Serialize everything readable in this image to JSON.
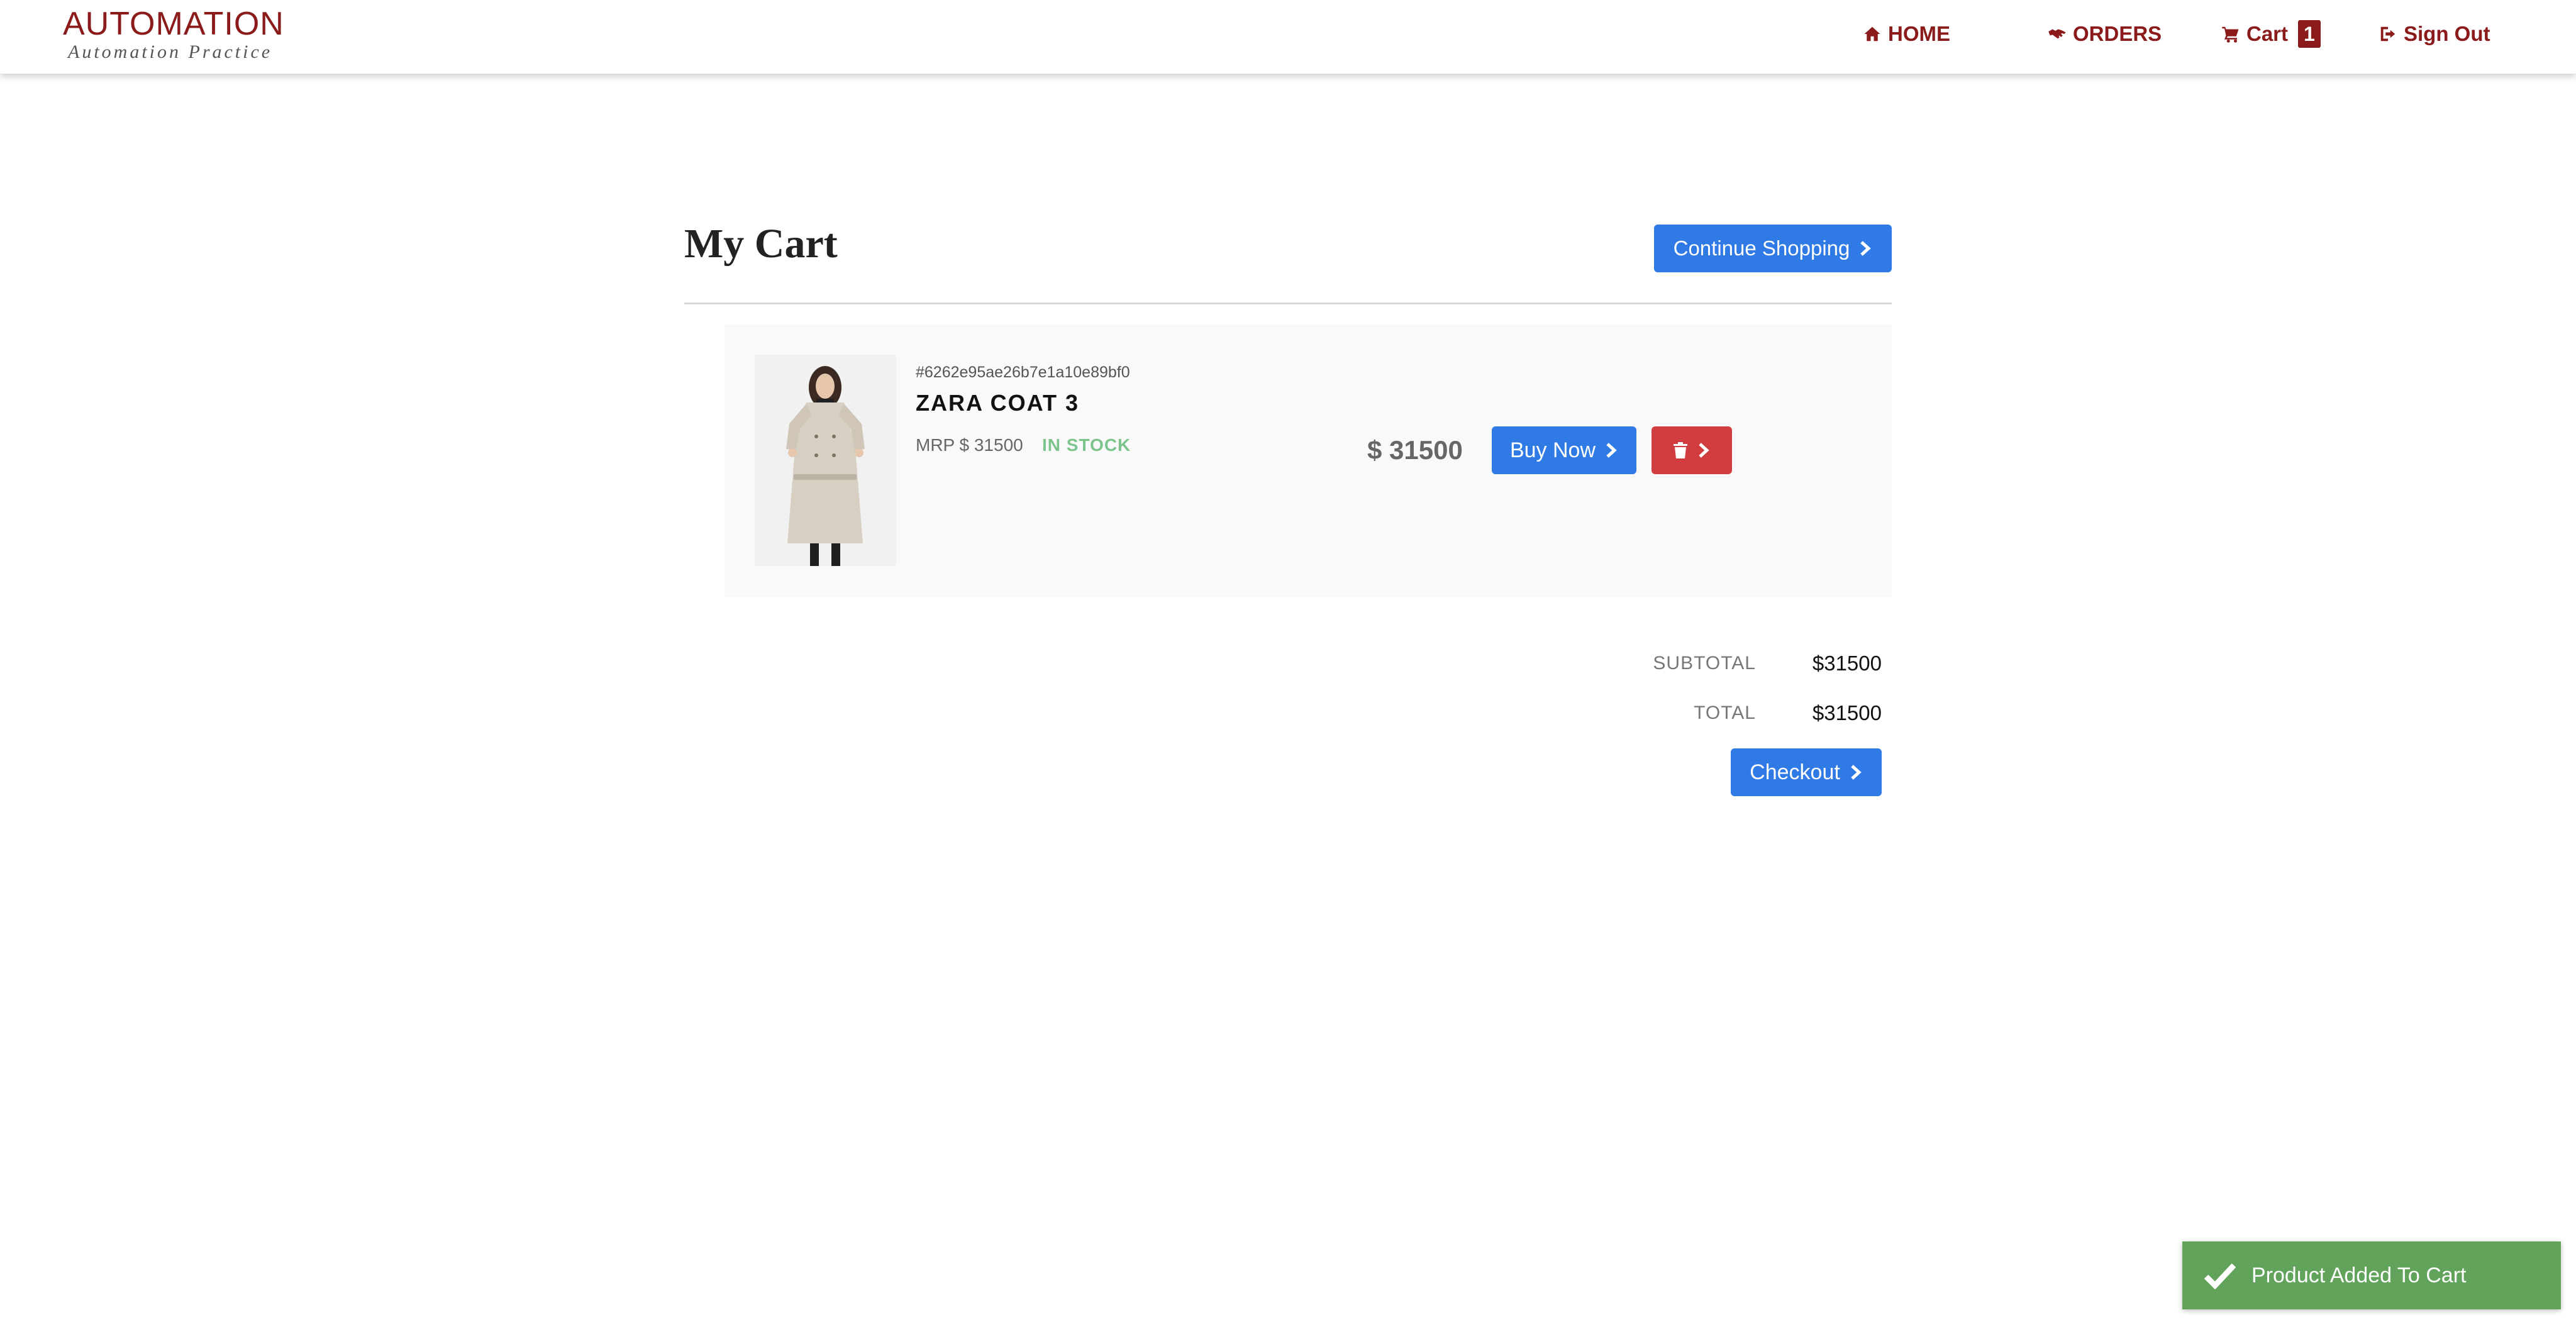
{
  "nav": {
    "brand_title": "AUTOMATION",
    "brand_sub": "Automation Practice",
    "home_label": "HOME",
    "orders_label": "ORDERS",
    "cart_label": "Cart",
    "cart_count": "1",
    "signout_label": "Sign Out",
    "icons": [
      "home-icon",
      "handshake-icon",
      "cart-icon",
      "sign-out-icon"
    ],
    "accent_color": "#8b1a1a"
  },
  "page": {
    "title": "My Cart",
    "continue_label": "Continue Shopping"
  },
  "cart_items": [
    {
      "id": "#6262e95ae26b7e1a10e89bf0",
      "name": "ZARA COAT 3",
      "mrp": "MRP $ 31500",
      "stock": "IN STOCK",
      "price": "$ 31500",
      "buy_label": "Buy Now",
      "icons": [
        "product-image",
        "chevron-right-icon",
        "trash-icon"
      ]
    }
  ],
  "totals": {
    "subtotal_label": "SUBTOTAL",
    "subtotal_value": "$31500",
    "total_label": "TOTAL",
    "total_value": "$31500",
    "checkout_label": "Checkout"
  },
  "toast": {
    "message": "Product Added To Cart",
    "color": "#62a35b",
    "icon": "check-icon"
  },
  "colors": {
    "primary_button": "#2f7ae5",
    "danger_button": "#d03c3f",
    "in_stock": "#7cc38c"
  }
}
